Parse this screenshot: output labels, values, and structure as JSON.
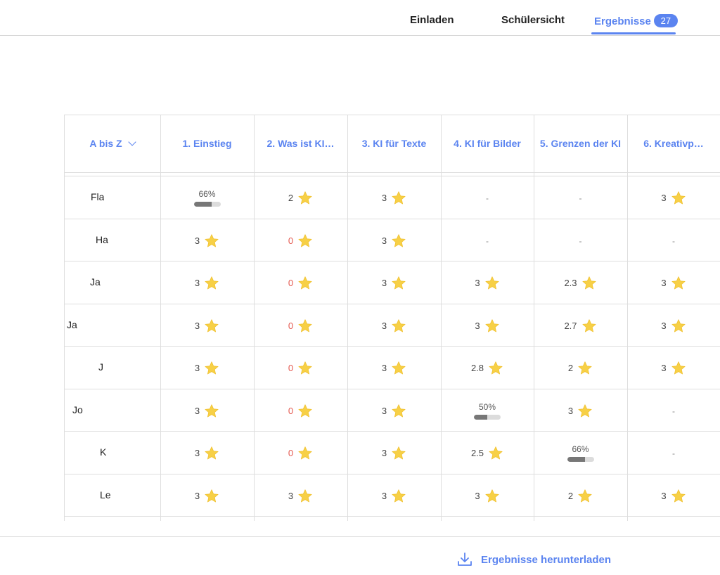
{
  "tabs": {
    "invite": "Einladen",
    "student_view": "Schülersicht",
    "results": "Ergebnisse",
    "results_count": "27"
  },
  "table": {
    "sort_label": "A bis Z",
    "columns": [
      "1. Einstieg",
      "2. Was ist KI…",
      "3. KI für Texte",
      "4. KI für Bilder",
      "5. Grenzen der KI",
      "6. Kreativp…"
    ],
    "rows": [
      {
        "name": "Fla",
        "cells": [
          {
            "type": "progress",
            "label": "66%",
            "value": 0.66
          },
          {
            "type": "score",
            "value": "2"
          },
          {
            "type": "score",
            "value": "3"
          },
          {
            "type": "dash",
            "value": "-"
          },
          {
            "type": "dash",
            "value": "-"
          },
          {
            "type": "score",
            "value": "3"
          }
        ]
      },
      {
        "name": "Ha",
        "cells": [
          {
            "type": "score",
            "value": "3"
          },
          {
            "type": "score",
            "value": "0"
          },
          {
            "type": "score",
            "value": "3"
          },
          {
            "type": "dash",
            "value": "-"
          },
          {
            "type": "dash",
            "value": "-"
          },
          {
            "type": "dash",
            "value": "-"
          }
        ]
      },
      {
        "name": "Ja",
        "cells": [
          {
            "type": "score",
            "value": "3"
          },
          {
            "type": "score",
            "value": "0"
          },
          {
            "type": "score",
            "value": "3"
          },
          {
            "type": "score",
            "value": "3"
          },
          {
            "type": "score",
            "value": "2.3"
          },
          {
            "type": "score",
            "value": "3"
          }
        ]
      },
      {
        "name": "Ja",
        "cells": [
          {
            "type": "score",
            "value": "3"
          },
          {
            "type": "score",
            "value": "0"
          },
          {
            "type": "score",
            "value": "3"
          },
          {
            "type": "score",
            "value": "3"
          },
          {
            "type": "score",
            "value": "2.7"
          },
          {
            "type": "score",
            "value": "3"
          }
        ]
      },
      {
        "name": "J",
        "cells": [
          {
            "type": "score",
            "value": "3"
          },
          {
            "type": "score",
            "value": "0"
          },
          {
            "type": "score",
            "value": "3"
          },
          {
            "type": "score",
            "value": "2.8"
          },
          {
            "type": "score",
            "value": "2"
          },
          {
            "type": "score",
            "value": "3"
          }
        ]
      },
      {
        "name": "Jo",
        "cells": [
          {
            "type": "score",
            "value": "3"
          },
          {
            "type": "score",
            "value": "0"
          },
          {
            "type": "score",
            "value": "3"
          },
          {
            "type": "progress",
            "label": "50%",
            "value": 0.5
          },
          {
            "type": "score",
            "value": "3"
          },
          {
            "type": "dash",
            "value": "-"
          }
        ]
      },
      {
        "name": "K",
        "cells": [
          {
            "type": "score",
            "value": "3"
          },
          {
            "type": "score",
            "value": "0"
          },
          {
            "type": "score",
            "value": "3"
          },
          {
            "type": "score",
            "value": "2.5"
          },
          {
            "type": "progress",
            "label": "66%",
            "value": 0.66
          },
          {
            "type": "dash",
            "value": "-"
          }
        ]
      },
      {
        "name": "Le",
        "cells": [
          {
            "type": "score",
            "value": "3"
          },
          {
            "type": "score",
            "value": "3"
          },
          {
            "type": "score",
            "value": "3"
          },
          {
            "type": "score",
            "value": "3"
          },
          {
            "type": "score",
            "value": "2"
          },
          {
            "type": "score",
            "value": "3"
          }
        ]
      }
    ]
  },
  "footer": {
    "download_label": "Ergebnisse herunterladen",
    "download_icon": "download-icon"
  },
  "colors": {
    "accent": "#5b84f0",
    "zero_score": "#e4584f",
    "star": "#f7d046",
    "progress_fill": "#777777",
    "progress_track": "#dcdcdc"
  }
}
